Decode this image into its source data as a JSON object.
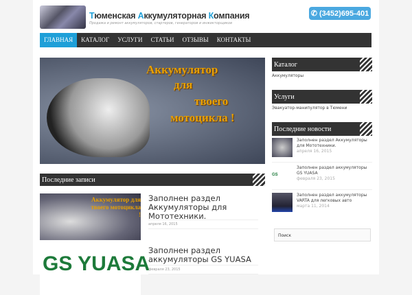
{
  "header": {
    "title_parts": [
      "Т",
      "юменская ",
      "А",
      "ккумуляторная ",
      "К",
      "омпания"
    ],
    "tagline": "Продажа и ремонт аккумуляторов, стартеров, генераторов и инжекторщиков",
    "phone": "(3452)695-401"
  },
  "nav": [
    "ГЛАВНАЯ",
    "КАТАЛОГ",
    "УСЛУГИ",
    "СТАТЬИ",
    "ОТЗЫВЫ",
    "КОНТАКТЫ"
  ],
  "slider": {
    "lines": [
      "Аккумулятор",
      "для",
      "твоего",
      "мотоцикла !"
    ]
  },
  "recent": {
    "heading": "Последние записи",
    "posts": [
      {
        "title": "Заполнен раздел Аккумуляторы для Мототехники.",
        "date": "апреля 16, 2015"
      },
      {
        "title": "Заполнен раздел аккумуляторы GS YUASA",
        "date": "февраля 23, 2015"
      }
    ]
  },
  "post_images": {
    "gs_logo": "GS YUASA",
    "moto_line1": "Аккумулятор для",
    "moto_line2": "твоего мотоцикла !"
  },
  "sidebar": {
    "catalog": {
      "heading": "Каталог",
      "link": "Аккумуляторы"
    },
    "services": {
      "heading": "Услуги",
      "link": "Эвакуатор-манипулятор в Тюмени"
    },
    "news": {
      "heading": "Последние новости",
      "items": [
        {
          "title": "Заполнен раздел Аккумуляторы для Мототехники.",
          "date": "апреля 16, 2015"
        },
        {
          "title": "Заполнен раздел аккумуляторы GS YUASA",
          "date": "февраля 23, 2015"
        },
        {
          "title": "Заполнен раздел аккумуляторы VARTA для легковых авто",
          "date": "марта 11, 2014"
        }
      ]
    },
    "search_placeholder": "Поиск"
  },
  "colors": {
    "accent": "#1e9fd8",
    "dark": "#333333",
    "phone": "#4aa8e0"
  }
}
